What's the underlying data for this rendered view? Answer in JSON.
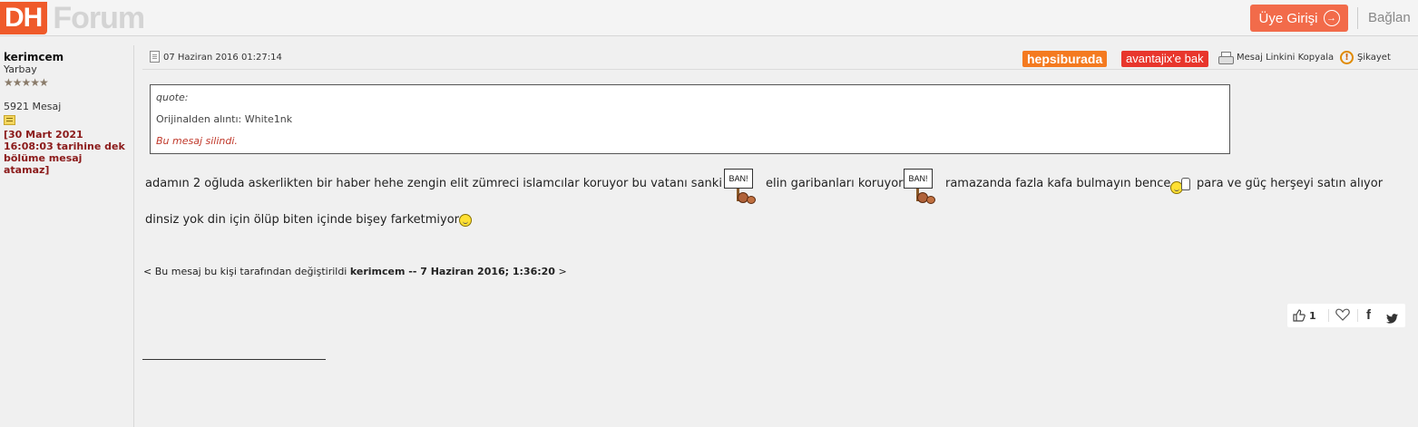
{
  "header": {
    "logo_dh": "DH",
    "logo_forum": "Forum",
    "login_label": "Üye Girişi",
    "connect_label": "Bağlan"
  },
  "user": {
    "name": "kerimcem",
    "rank": "Yarbay",
    "stars": "★★★★★",
    "messages": "5921 Mesaj",
    "ban_notice": "[30 Mart 2021 16:08:03 tarihine dek bölüme mesaj atamaz]"
  },
  "post": {
    "date": "07 Haziran 2016 01:27:14",
    "hepsiburada": "hepsiburada",
    "avantajix": "avantajix'e bak",
    "copy_link": "Mesaj Linkini Kopyala",
    "complaint": "Şikayet",
    "quote": {
      "label": "quote:",
      "original": "Orijinalden alıntı: White1nk",
      "deleted": "Bu mesaj silindi."
    },
    "body": {
      "seg1": "adamın 2 oğluda askerlikten bir haber hehe zengin elit zümreci islamcılar koruyor bu vatanı sanki",
      "ban_sign": "BAN!",
      "seg2": "elin garibanları koruyor",
      "seg3": "ramazanda fazla kafa bulmayın bence",
      "seg4": "para ve güç herşeyi satın alıyor",
      "seg5": "dinsiz yok din için ölüp biten içinde bişey farketmiyor"
    },
    "edit_note": {
      "prefix": "< Bu mesaj bu kişi tarafından değiştirildi",
      "editor": "kerimcem -- 7 Haziran 2016; 1:36:20",
      "suffix": ">"
    },
    "likes": "1"
  }
}
